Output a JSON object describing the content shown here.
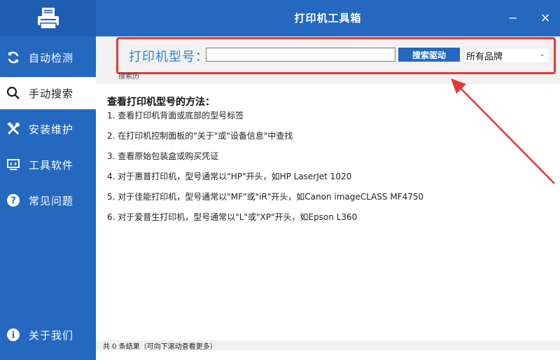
{
  "window": {
    "title": "打印机工具箱",
    "minimize_glyph": "−",
    "close_glyph": "×"
  },
  "sidebar": {
    "logo_icon": "printer-icon",
    "items": [
      {
        "label": "自动检测",
        "icon": "refresh-icon"
      },
      {
        "label": "手动搜索",
        "icon": "search-icon",
        "active": true
      },
      {
        "label": "安装维护",
        "icon": "tools-icon"
      },
      {
        "label": "工具软件",
        "icon": "monitor-icon"
      },
      {
        "label": "常见问题",
        "icon": "question-icon"
      },
      {
        "label": "关于我们",
        "icon": "info-icon"
      }
    ],
    "color": "#2468c0"
  },
  "search": {
    "label": "打印机型号：",
    "input_value": "",
    "button_label": "搜索驱动",
    "brand_selected": "所有品牌",
    "history_label": "搜索历",
    "highlight_color": "#e53935"
  },
  "help": {
    "title": "查看打印机型号的方法：",
    "lines": [
      "1. 查看打印机背面或底部的型号标签",
      "2. 在打印机控制面板的\"关于\"或\"设备信息\"中查找",
      "3. 查看原始包装盒或购买凭证",
      "4. 对于惠普打印机，型号通常以\"HP\"开头，如HP LaserJet 1020",
      "5. 对于佳能打印机，型号通常以\"MF\"或\"iR\"开头，如Canon imageCLASS MF4750",
      "6. 对于爱普生打印机，型号通常以\"L\"或\"XP\"开头，如Epson L360"
    ]
  },
  "status": {
    "text": "共 0 条结果（可向下滚动查看更多）"
  }
}
